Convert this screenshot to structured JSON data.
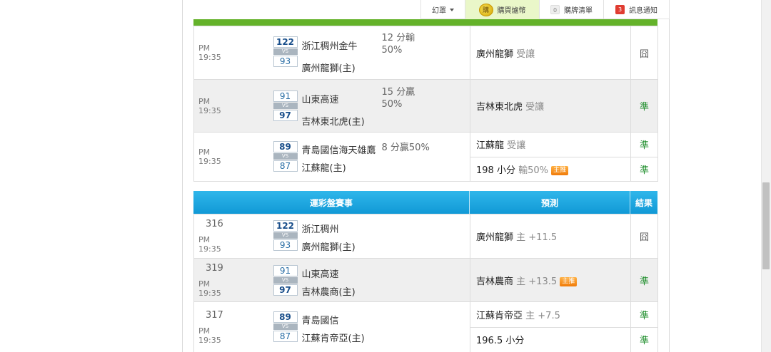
{
  "topbar": {
    "menu_label": "幻罩",
    "buy_coin_icon_text": "購",
    "buy_label": "購買爐幣",
    "cart_count": "0",
    "cart_label": "購牌清單",
    "notice_count": "3",
    "notice_label": "訊息通知"
  },
  "colors": {
    "green_bar": "#64b22a",
    "header_blue": "#1ca5e0",
    "result_green": "#1d8d2a",
    "badge_red": "#e03c31"
  },
  "section1": {
    "rows": [
      {
        "time": "PM 19:35",
        "score_a": "122",
        "score_b": "93",
        "vs": "VS",
        "team_a": "浙江稠州金牛",
        "team_b": "廣州龍獅(主)",
        "odds_1": "12 分輸",
        "odds_2": "50%",
        "predictions": [
          {
            "main": "廣州龍獅",
            "sub": "受讓",
            "result": "囧"
          }
        ]
      },
      {
        "time": "PM 19:35",
        "score_a": "91",
        "score_b": "97",
        "vs": "VS",
        "team_a": "山東高速",
        "team_b": "吉林東北虎(主)",
        "odds_1": "15 分贏",
        "odds_2": "50%",
        "predictions": [
          {
            "main": "吉林東北虎",
            "sub": "受讓",
            "result": "準"
          }
        ]
      },
      {
        "time": "PM 19:35",
        "score_a": "89",
        "score_b": "87",
        "vs": "VS",
        "team_a": "青島國信海天雄鷹",
        "team_b": "江蘇龍(主)",
        "odds_1": "8 分贏50%",
        "odds_2": "",
        "predictions": [
          {
            "main": "江蘇龍",
            "sub": "受讓",
            "result": "準"
          },
          {
            "main": "198 小分",
            "sub": "輸50%",
            "tag": "主推",
            "result": "準"
          }
        ]
      }
    ]
  },
  "section2": {
    "headers": {
      "match": "運彩盤賽事",
      "prediction": "預測",
      "result": "結果"
    },
    "rows": [
      {
        "num": "316",
        "time": "PM 19:35",
        "score_a": "122",
        "score_b": "93",
        "vs": "VS",
        "team_a": "浙江稠州",
        "team_b": "廣州龍獅(主)",
        "predictions": [
          {
            "main": "廣州龍獅",
            "sub": "主 +11.5",
            "result": "囧"
          }
        ]
      },
      {
        "num": "319",
        "time": "PM 19:35",
        "score_a": "91",
        "score_b": "97",
        "vs": "VS",
        "team_a": "山東高速",
        "team_b": "吉林農商(主)",
        "predictions": [
          {
            "main": "吉林農商",
            "sub": "主 +13.5",
            "tag": "主推",
            "result": "準"
          }
        ]
      },
      {
        "num": "317",
        "time": "PM 19:35",
        "score_a": "89",
        "score_b": "87",
        "vs": "VS",
        "team_a": "青島國信",
        "team_b": "江蘇肯帝亞(主)",
        "predictions": [
          {
            "main": "江蘇肯帝亞",
            "sub": "主 +7.5",
            "result": "準"
          },
          {
            "main": "196.5 小分",
            "sub": "",
            "result": "準"
          }
        ]
      }
    ]
  }
}
